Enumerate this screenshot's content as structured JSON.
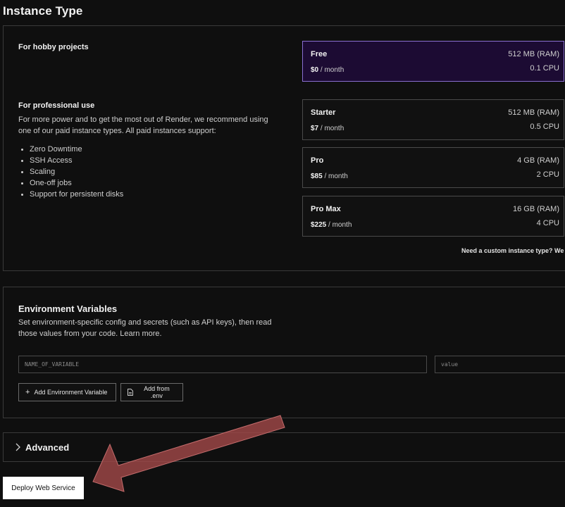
{
  "page": {
    "title": "Instance Type"
  },
  "instance": {
    "hobby_label": "For hobby projects",
    "pro_label": "For professional use",
    "pro_description": "For more power and to get the most out of Render, we recommend using one of our paid instance types. All paid instances support:",
    "features": [
      "Zero Downtime",
      "SSH Access",
      "Scaling",
      "One-off jobs",
      "Support for persistent disks"
    ],
    "plans": [
      {
        "name": "Free",
        "price": "$0",
        "period": " / month",
        "ram": "512 MB (RAM)",
        "cpu": "0.1 CPU",
        "selected": true
      },
      {
        "name": "Starter",
        "price": "$7",
        "period": " / month",
        "ram": "512 MB (RAM)",
        "cpu": "0.5 CPU",
        "selected": false
      },
      {
        "name": "Pro",
        "price": "$85",
        "period": " / month",
        "ram": "4 GB (RAM)",
        "cpu": "2 CPU",
        "selected": false
      },
      {
        "name": "Pro Max",
        "price": "$225",
        "period": " / month",
        "ram": "16 GB (RAM)",
        "cpu": "4 CPU",
        "selected": false
      }
    ],
    "custom_note": "Need a custom instance type? We s..."
  },
  "env": {
    "title": "Environment Variables",
    "description": "Set environment-specific config and secrets (such as API keys), then read those values from your code. Learn more.",
    "name_placeholder": "NAME_OF_VARIABLE",
    "value_placeholder": "value",
    "add_button": "Add Environment Variable",
    "add_from_env_button": "Add from .env"
  },
  "advanced": {
    "label": "Advanced"
  },
  "deploy": {
    "label": "Deploy Web Service"
  },
  "colors": {
    "background": "#0f0f0f",
    "selected_card_bg": "#1c0b33",
    "selected_card_border": "#8a6fd1",
    "annotation_arrow": "#a04848"
  }
}
